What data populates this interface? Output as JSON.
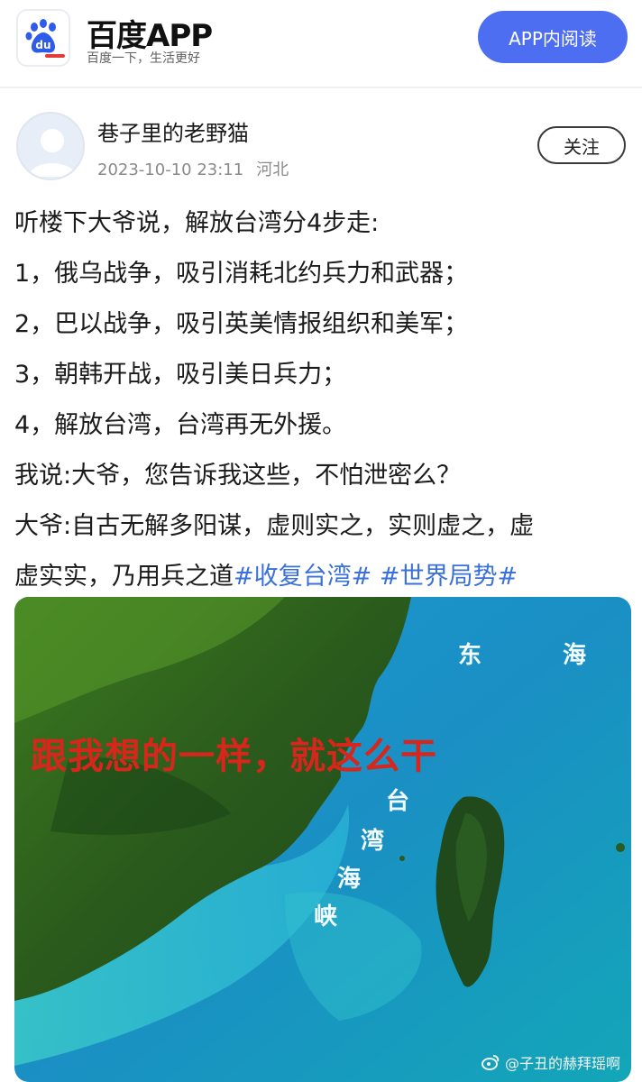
{
  "header": {
    "brand": "百度APP",
    "slogan": "百度一下，生活更好",
    "logo_text": "du",
    "open_button": "APP内阅读",
    "logo_icon": "baidu-paw-icon"
  },
  "post": {
    "author": "巷子里的老野猫",
    "datetime": "2023-10-10 23:11",
    "location": "河北",
    "follow_label": "关注",
    "lines": [
      "听楼下大爷说，解放台湾分4步走:",
      "1，俄乌战争，吸引消耗北约兵力和武器；",
      "2，巴以战争，吸引英美情报组织和美军；",
      "3，朝韩开战，吸引美日兵力；",
      "4，解放台湾，台湾再无外援。",
      "我说:大爷，您告诉我这些，不怕泄密么？",
      "大爷:自古无解多阳谋，虚则实之，实则虚之，虚"
    ],
    "last_line_text": "虚实实，乃用兵之道",
    "tag1": "#收复台湾#",
    "tag2": "#世界局势#"
  },
  "image": {
    "overlay_text": "跟我想的一样，就这么干",
    "label_east_1": "东",
    "label_east_2": "海",
    "strait_1": "台",
    "strait_2": "湾",
    "strait_3": "海",
    "strait_4": "峡",
    "watermark": "@子丑的赫拜瑶啊",
    "colors": {
      "sea": "#1aa6cf",
      "land": "#1f4a1e",
      "overlay_red": "#d7261b"
    }
  }
}
